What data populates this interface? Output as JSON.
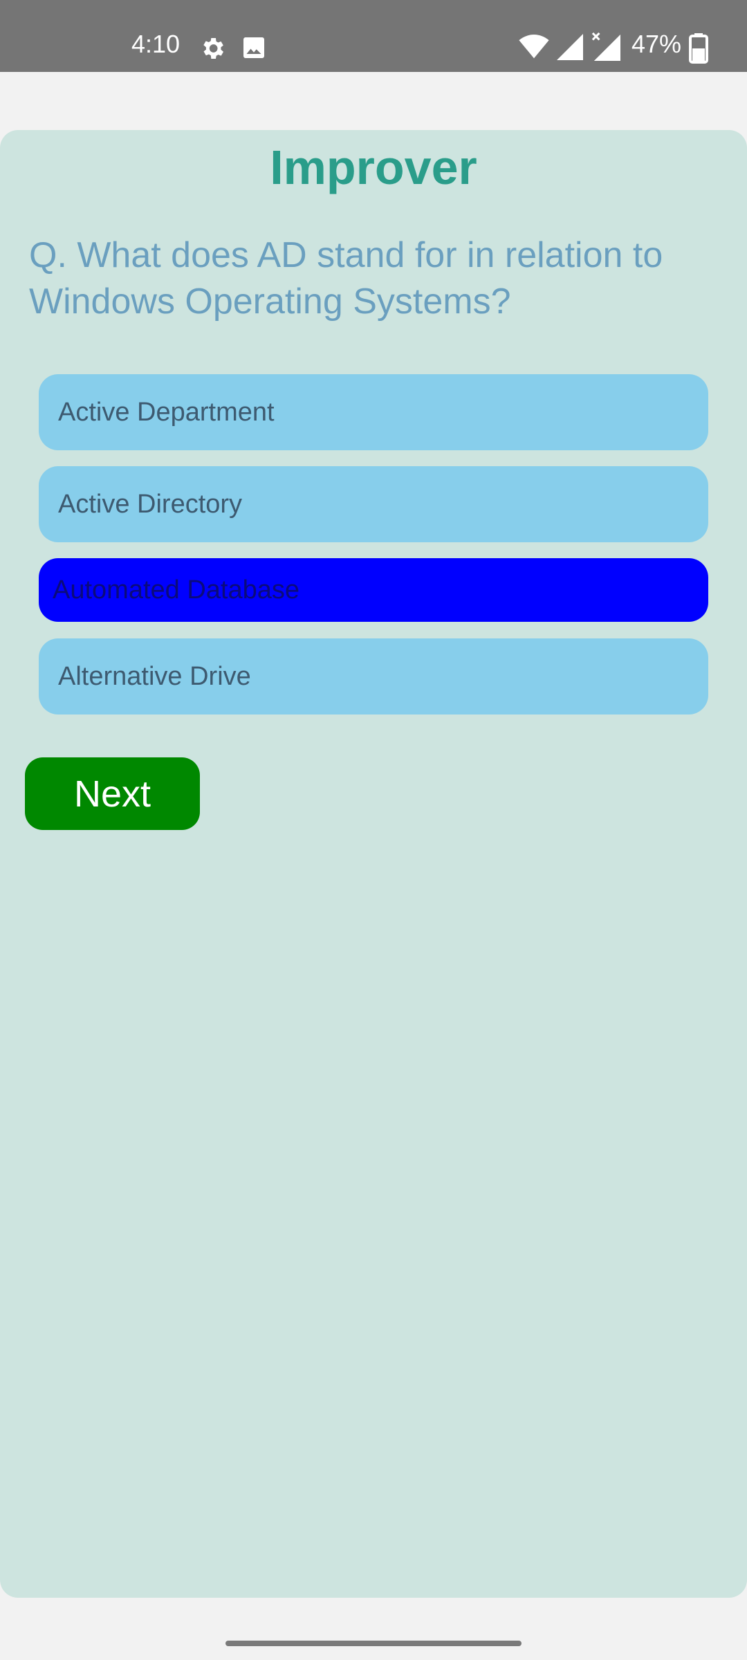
{
  "status_bar": {
    "time": "4:10",
    "battery": "47%",
    "icons": [
      "gear-icon",
      "image-icon",
      "wifi-icon",
      "cell-signal-icon",
      "cell-signal-no-data-icon",
      "battery-icon"
    ]
  },
  "app": {
    "title": "Improver"
  },
  "quiz": {
    "question": "Q. What does AD stand for in relation to Windows Operating Systems?",
    "options": [
      {
        "label": "Active Department",
        "selected": false
      },
      {
        "label": "Active Directory",
        "selected": false
      },
      {
        "label": "Automated Database",
        "selected": true
      },
      {
        "label": "Alternative Drive",
        "selected": false
      }
    ],
    "next_label": "Next"
  },
  "colors": {
    "status_bar": "#757575",
    "card": "#cde4df",
    "title": "#2a9d8a",
    "question": "#6a9fbf",
    "option": "#87ceeb",
    "option_selected": "#0000ff",
    "next_button": "#008800"
  }
}
